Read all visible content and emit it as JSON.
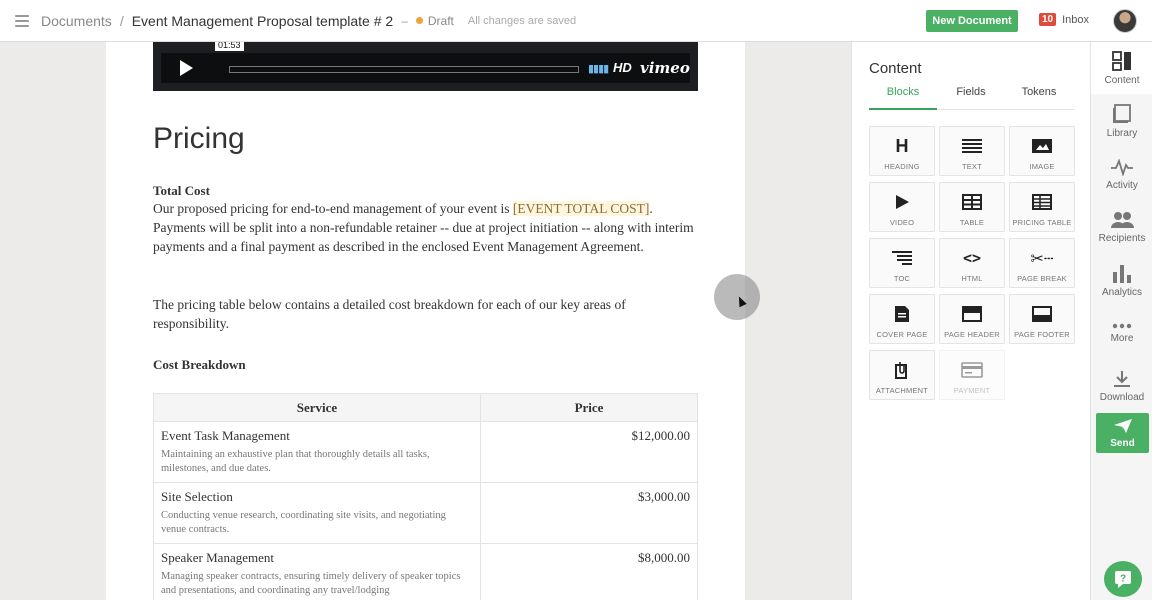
{
  "topbar": {
    "breadcrumb_root": "Documents",
    "separator": "/",
    "doc_title": "Event Management Proposal template # 2",
    "dash": "–",
    "status": "Draft",
    "saved_text": "All changes are saved",
    "new_document_label": "New Document",
    "inbox_count": "10",
    "inbox_label": "Inbox"
  },
  "video": {
    "timestamp": "01:53",
    "hd": "HD",
    "brand": "vimeo"
  },
  "document": {
    "heading": "Pricing",
    "total_cost_title": "Total Cost",
    "total_cost_text_1": "Our proposed pricing for end-to-end management of your event is ",
    "total_cost_token": "[EVENT TOTAL COST]",
    "total_cost_text_2": ". Payments will be split into a non-refundable retainer -- due at project initiation -- along with interim payments and a final payment as described in the enclosed Event Management Agreement.",
    "breakdown_intro": "The pricing table below contains a detailed cost breakdown for each of our key areas of responsibility.",
    "cost_breakdown_title": "Cost Breakdown",
    "table": {
      "headers": [
        "Service",
        "Price"
      ],
      "rows": [
        {
          "service": "Event Task Management",
          "desc": "Maintaining an exhaustive plan that thoroughly details all tasks, milestones, and due dates.",
          "price": "$12,000.00"
        },
        {
          "service": "Site Selection",
          "desc": "Conducting venue research, coordinating site visits, and negotiating venue contracts.",
          "price": "$3,000.00"
        },
        {
          "service": "Speaker Management",
          "desc": "Managing speaker contracts, ensuring timely delivery of speaker topics and presentations, and coordinating any travel/lodging",
          "price": "$8,000.00"
        }
      ]
    }
  },
  "panel": {
    "title": "Content",
    "tabs": [
      "Blocks",
      "Fields",
      "Tokens"
    ],
    "blocks": [
      {
        "label": "HEADING",
        "icon": "heading-icon"
      },
      {
        "label": "TEXT",
        "icon": "text-icon"
      },
      {
        "label": "IMAGE",
        "icon": "image-icon"
      },
      {
        "label": "VIDEO",
        "icon": "video-icon"
      },
      {
        "label": "TABLE",
        "icon": "table-icon"
      },
      {
        "label": "PRICING TABLE",
        "icon": "pricing-table-icon"
      },
      {
        "label": "TOC",
        "icon": "toc-icon"
      },
      {
        "label": "HTML",
        "icon": "html-icon"
      },
      {
        "label": "PAGE BREAK",
        "icon": "page-break-icon"
      },
      {
        "label": "COVER PAGE",
        "icon": "cover-page-icon"
      },
      {
        "label": "PAGE HEADER",
        "icon": "page-header-icon"
      },
      {
        "label": "PAGE FOOTER",
        "icon": "page-footer-icon"
      },
      {
        "label": "ATTACHMENT",
        "icon": "attachment-icon"
      },
      {
        "label": "PAYMENT",
        "icon": "payment-icon"
      }
    ]
  },
  "sidebar": {
    "items": [
      {
        "label": "Content",
        "icon": "content-icon"
      },
      {
        "label": "Library",
        "icon": "library-icon"
      },
      {
        "label": "Activity",
        "icon": "activity-icon"
      },
      {
        "label": "Recipients",
        "icon": "recipients-icon"
      },
      {
        "label": "Analytics",
        "icon": "analytics-icon"
      },
      {
        "label": "More",
        "icon": "more-icon"
      },
      {
        "label": "Download",
        "icon": "download-icon"
      }
    ],
    "send_label": "Send"
  },
  "colors": {
    "accent_green": "#4ab063",
    "tab_green": "#3aa35a",
    "draft_orange": "#f0a23a",
    "inbox_red": "#e04a3a",
    "video_blue": "#6bb5e8"
  }
}
